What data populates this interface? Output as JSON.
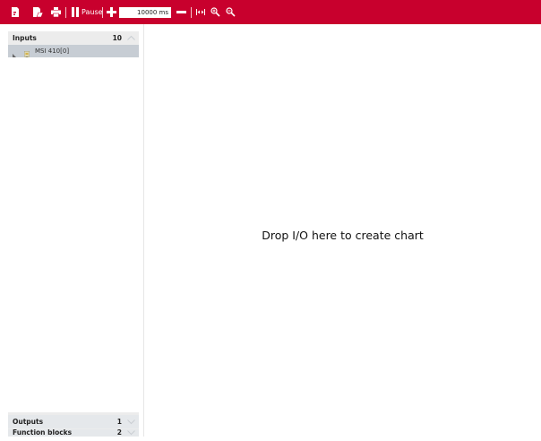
{
  "toolbar": {
    "new_icon": "document-new-icon",
    "open_icon": "document-open-icon",
    "print_icon": "print-icon",
    "pause_icon": "pause-icon",
    "pause_label": "Pause",
    "zoom_in_time_icon": "plus-icon",
    "time_window_value": "10000 ms",
    "zoom_out_time_icon": "minus-icon",
    "fit_icon": "fit-width-icon",
    "zoom_in_icon": "zoom-in-icon",
    "zoom_out_icon": "zoom-out-icon",
    "accent_color": "#c8002d"
  },
  "inputs_panel": {
    "title": "Inputs",
    "count": "10",
    "items": [
      {
        "label": "MSI 410[0]",
        "icon": "device-module-icon"
      }
    ]
  },
  "outputs_panel": {
    "title": "Outputs",
    "count": "1"
  },
  "function_blocks_panel": {
    "title": "Function blocks",
    "count": "2"
  },
  "chart_area": {
    "hint": "Drop I/O here to create chart"
  }
}
